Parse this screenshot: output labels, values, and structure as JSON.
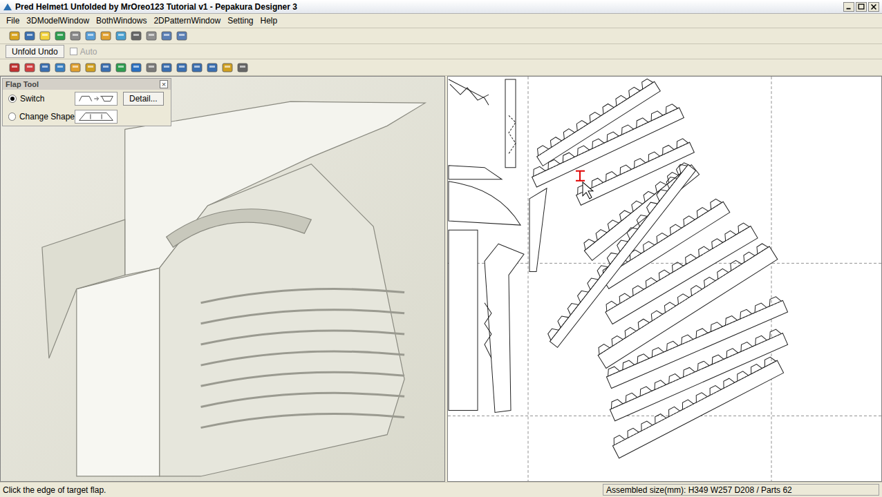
{
  "window": {
    "title": "Pred Helmet1 Unfolded by MrOreo123 Tutorial v1 - Pepakura Designer 3"
  },
  "menu": [
    "File",
    "3DModelWindow",
    "BothWindows",
    "2DPatternWindow",
    "Setting",
    "Help"
  ],
  "unfold_bar": {
    "button": "Unfold Undo",
    "auto": {
      "label": "Auto",
      "checked": false,
      "disabled": true
    }
  },
  "flap_tool": {
    "title": "Flap Tool",
    "close": "×",
    "options": [
      {
        "label": "Switch",
        "selected": true
      },
      {
        "label": "Change Shape",
        "selected": false
      }
    ],
    "detail_button": "Detail..."
  },
  "status_bar": {
    "hint": "Click the edge of target flap.",
    "size": "Assembled size(mm): H349 W257 D208 / Parts 62"
  }
}
